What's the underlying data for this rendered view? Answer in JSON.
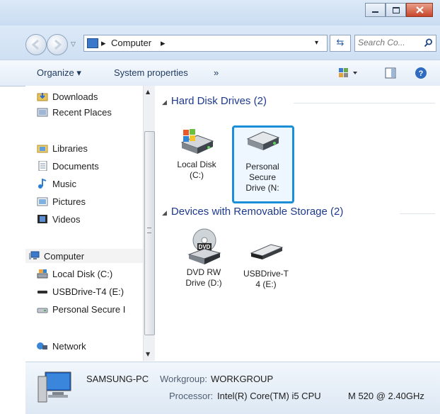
{
  "window": {
    "controls": {
      "minimize_icon": "minimize-icon",
      "maximize_icon": "maximize-icon",
      "close_icon": "close-icon"
    }
  },
  "address_bar": {
    "crumbs": [
      "Computer"
    ],
    "search_placeholder": "Search Co...",
    "back_icon": "back-arrow-icon",
    "forward_icon": "forward-arrow-icon",
    "refresh_icon": "refresh-icon",
    "search_icon": "search-icon"
  },
  "toolbar": {
    "organize_label": "Organize ▾",
    "system_properties_label": "System properties",
    "more_label": "»"
  },
  "sidebar": {
    "items": [
      {
        "label": "Downloads",
        "icon": "downloads-folder-icon"
      },
      {
        "label": "Recent Places",
        "icon": "recent-places-icon"
      },
      {
        "label": "Libraries",
        "icon": "libraries-icon"
      },
      {
        "label": "Documents",
        "icon": "documents-icon"
      },
      {
        "label": "Music",
        "icon": "music-icon"
      },
      {
        "label": "Pictures",
        "icon": "pictures-icon"
      },
      {
        "label": "Videos",
        "icon": "videos-icon"
      },
      {
        "label": "Computer",
        "icon": "computer-icon"
      },
      {
        "label": "Local Disk (C:)",
        "icon": "local-disk-icon"
      },
      {
        "label": "USBDrive-T4 (E:)",
        "icon": "usb-drive-icon"
      },
      {
        "label": "Personal Secure I",
        "icon": "secure-drive-icon"
      },
      {
        "label": "Network",
        "icon": "network-icon"
      }
    ]
  },
  "content": {
    "groups": [
      {
        "title": "Hard Disk Drives (2)",
        "drives": [
          {
            "line1": "Local Disk",
            "line2": "(C:)",
            "line3": "",
            "icon": "windows-disk-icon"
          },
          {
            "line1": "Personal",
            "line2": "Secure",
            "line3": "Drive (N:",
            "icon": "secure-disk-icon",
            "selected": true
          }
        ]
      },
      {
        "title": "Devices with Removable Storage (2)",
        "drives": [
          {
            "line1": "DVD RW",
            "line2": "Drive (D:)",
            "line3": "",
            "icon": "dvd-drive-icon"
          },
          {
            "line1": "USBDrive-T",
            "line2": "4 (E:)",
            "line3": "",
            "icon": "usb-drive-icon"
          }
        ]
      }
    ]
  },
  "details": {
    "pc_name": "SAMSUNG-PC",
    "workgroup_label": "Workgroup:",
    "workgroup_value": "WORKGROUP",
    "processor_label": "Processor:",
    "processor_value": "Intel(R) Core(TM) i5 CPU",
    "processor_extra": "M 520  @ 2.40GHz"
  }
}
